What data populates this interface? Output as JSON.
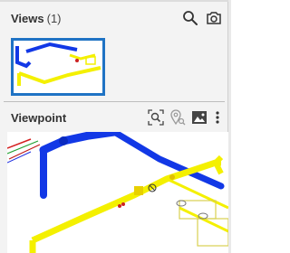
{
  "views": {
    "title": "Views",
    "count": "(1)",
    "icons": [
      "search-icon",
      "camera-icon"
    ]
  },
  "viewpoint": {
    "title": "Viewpoint",
    "icons": [
      "zoom-fit-icon",
      "location-pin-icon",
      "image-icon",
      "more-vertical-icon"
    ]
  },
  "colors": {
    "accent": "#1f73c4",
    "pipe_blue": "#1238e6",
    "pipe_yellow": "#f4f000",
    "panel_bg": "#f3f3f3"
  }
}
